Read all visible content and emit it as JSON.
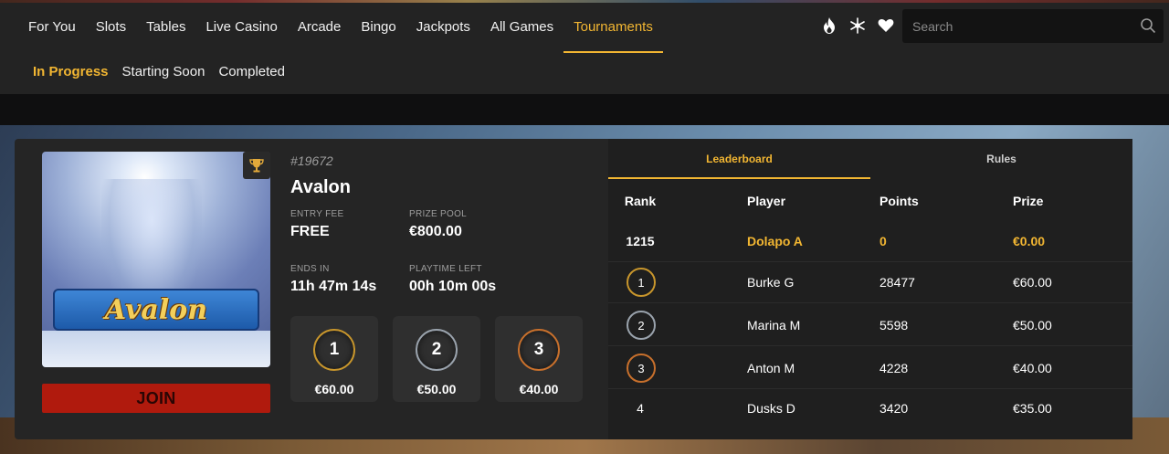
{
  "nav": {
    "items": [
      {
        "label": "For You"
      },
      {
        "label": "Slots"
      },
      {
        "label": "Tables"
      },
      {
        "label": "Live Casino"
      },
      {
        "label": "Arcade"
      },
      {
        "label": "Bingo"
      },
      {
        "label": "Jackpots"
      },
      {
        "label": "All Games"
      },
      {
        "label": "Tournaments",
        "active": true
      }
    ],
    "icons": [
      "fire-icon",
      "snowflake-icon",
      "heart-icon"
    ],
    "search_placeholder": "Search"
  },
  "subnav": {
    "items": [
      {
        "label": "In Progress",
        "active": true
      },
      {
        "label": "Starting Soon"
      },
      {
        "label": "Completed"
      }
    ]
  },
  "tournament": {
    "id": "#19672",
    "name": "Avalon",
    "game_logo_text": "Avalon",
    "entry_fee_label": "ENTRY FEE",
    "entry_fee": "FREE",
    "prize_pool_label": "PRIZE POOL",
    "prize_pool": "€800.00",
    "ends_in_label": "ENDS IN",
    "ends_in": "11h 47m 14s",
    "playtime_left_label": "PLAYTIME LEFT",
    "playtime_left": "00h 10m 00s",
    "join_label": "JOIN",
    "prizes": [
      {
        "place": "1",
        "amount": "€60.00",
        "color": "#c8962c"
      },
      {
        "place": "2",
        "amount": "€50.00",
        "color": "#9aa3ad"
      },
      {
        "place": "3",
        "amount": "€40.00",
        "color": "#c8702c"
      }
    ]
  },
  "leaderboard": {
    "tabs": [
      {
        "label": "Leaderboard",
        "active": true
      },
      {
        "label": "Rules"
      }
    ],
    "headers": {
      "rank": "Rank",
      "player": "Player",
      "points": "Points",
      "prize": "Prize"
    },
    "me": {
      "rank": "1215",
      "player": "Dolapo A",
      "points": "0",
      "prize": "€0.00"
    },
    "rows": [
      {
        "rank": "1",
        "player": "Burke G",
        "points": "28477",
        "prize": "€60.00",
        "ring_color": "#c8962c"
      },
      {
        "rank": "2",
        "player": "Marina M",
        "points": "5598",
        "prize": "€50.00",
        "ring_color": "#9aa3ad"
      },
      {
        "rank": "3",
        "player": "Anton M",
        "points": "4228",
        "prize": "€40.00",
        "ring_color": "#c8702c"
      },
      {
        "rank": "4",
        "player": "Dusks D",
        "points": "3420",
        "prize": "€35.00"
      }
    ]
  },
  "colors": {
    "accent": "#f2b632",
    "join": "#b01a0d",
    "panel": "#252525"
  }
}
